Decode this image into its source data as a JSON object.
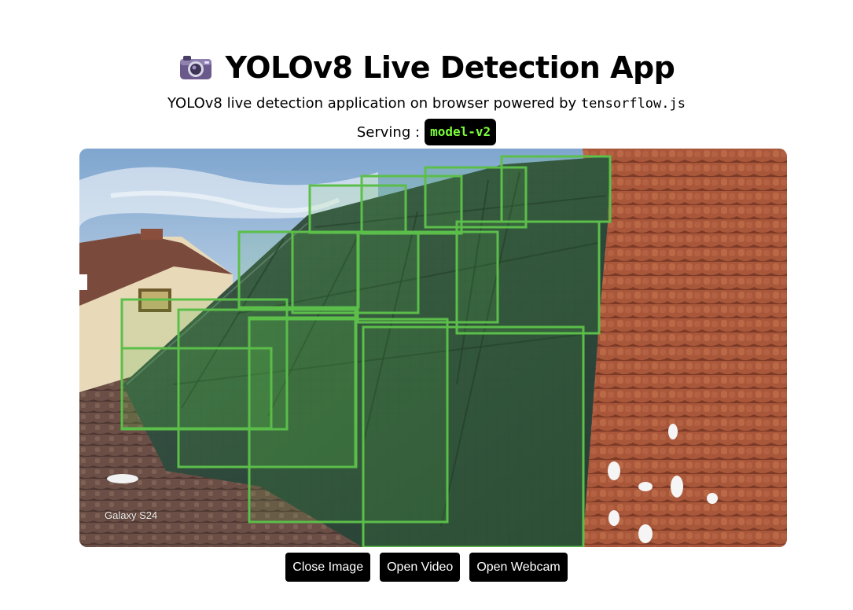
{
  "header": {
    "title": "YOLOv8 Live Detection App",
    "subtitle_prefix": "YOLOv8 live detection application on browser powered by ",
    "subtitle_code": "tensorflow.js",
    "serving_label": "Serving :",
    "model_name": "model-v2"
  },
  "viewer": {
    "watermark": "Galaxy S24",
    "box_color": "#5cbf4a",
    "detections_count": 13
  },
  "buttons": {
    "close_image": "Close Image",
    "open_video": "Open Video",
    "open_webcam": "Open Webcam"
  },
  "colors": {
    "badge_bg": "#000000",
    "badge_text": "#7bff3b",
    "button_bg": "#000000",
    "button_text": "#ffffff"
  }
}
